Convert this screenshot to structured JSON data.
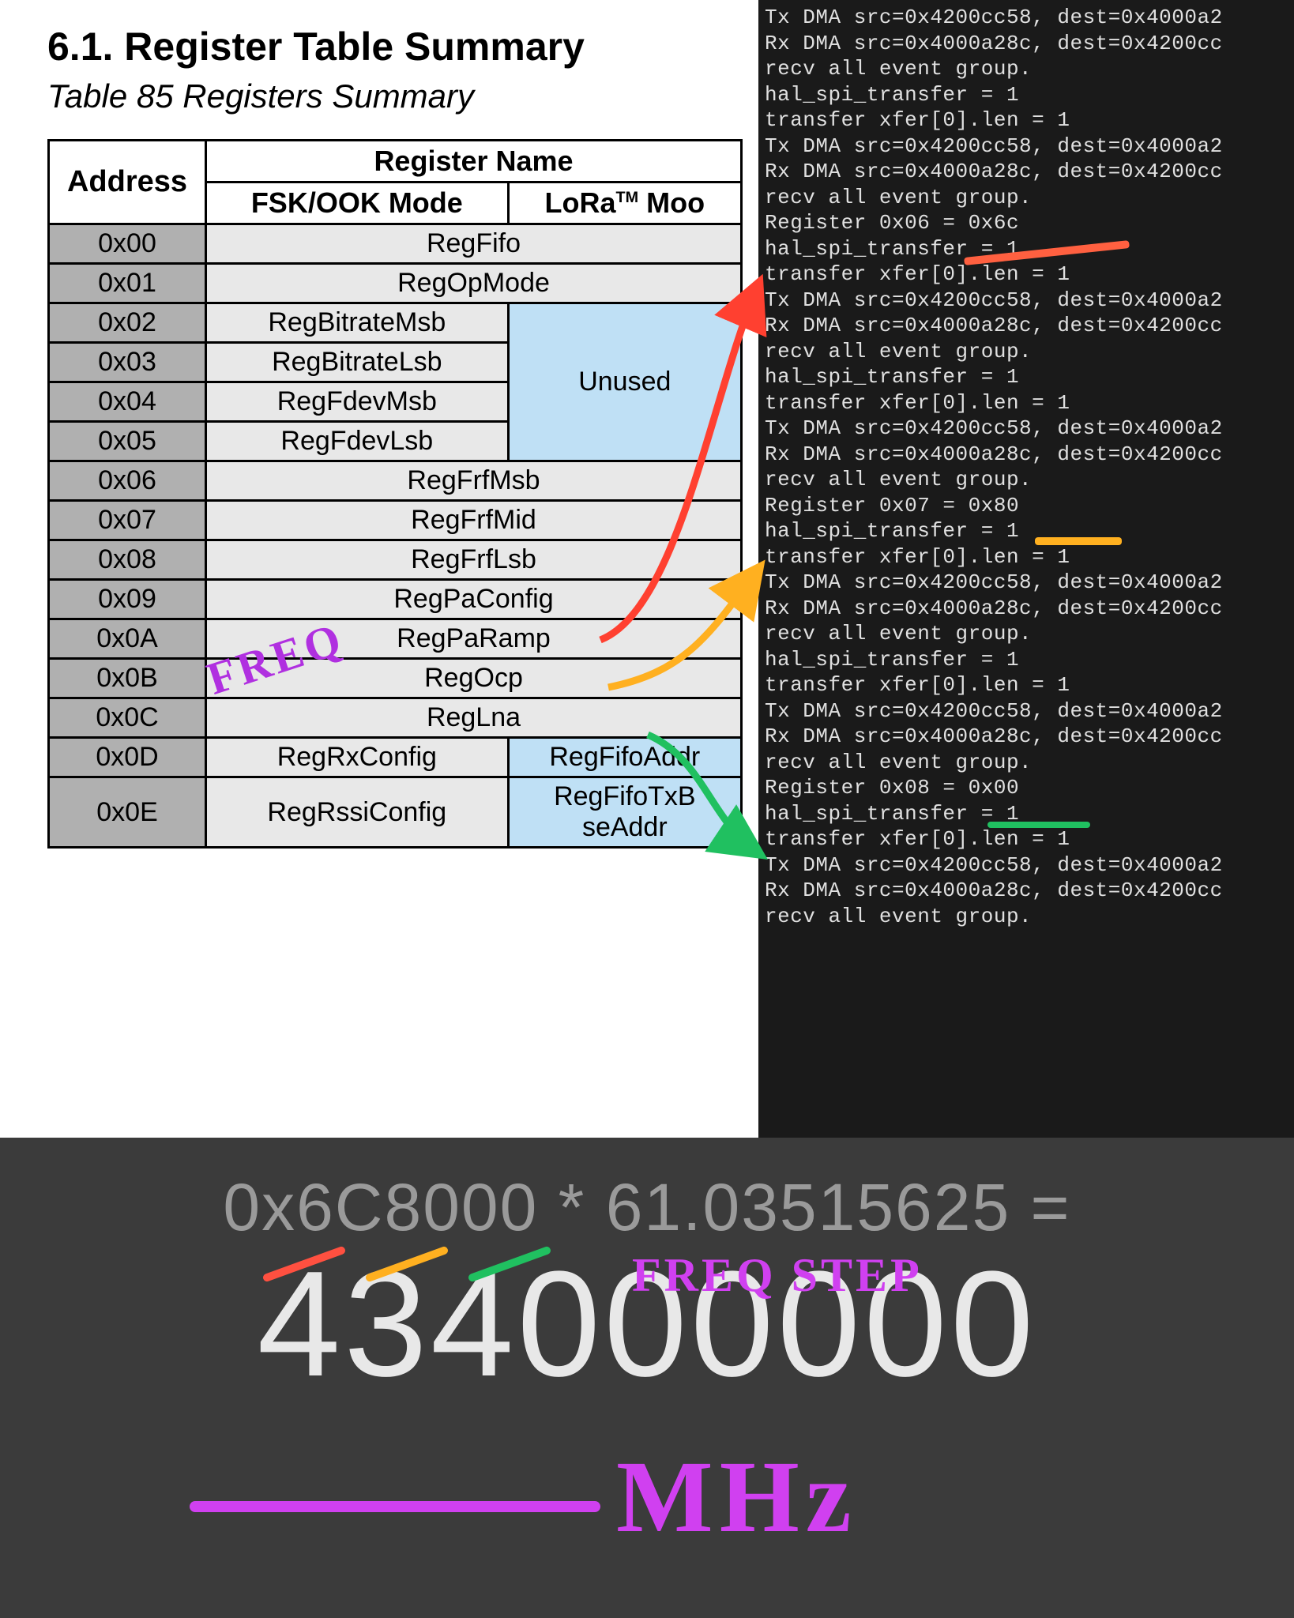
{
  "doc": {
    "heading": "6.1.  Register Table Summary",
    "subhead": "Table 85  Registers Summary",
    "hdr_address": "Address",
    "hdr_regname": "Register Name",
    "hdr_fsk": "FSK/OOK Mode",
    "hdr_lora_pre": "LoRa",
    "hdr_lora_tm": "TM",
    "hdr_lora_post": " Moo",
    "rows": {
      "r00": "0x00",
      "v00": "RegFifo",
      "r01": "0x01",
      "v01": "RegOpMode",
      "r02": "0x02",
      "v02": "RegBitrateMsb",
      "r03": "0x03",
      "v03": "RegBitrateLsb",
      "r04": "0x04",
      "v04": "RegFdevMsb",
      "r05": "0x05",
      "v05": "RegFdevLsb",
      "unused": "Unused",
      "r06": "0x06",
      "v06": "RegFrfMsb",
      "r07": "0x07",
      "v07": "RegFrfMid",
      "r08": "0x08",
      "v08": "RegFrfLsb",
      "r09": "0x09",
      "v09": "RegPaConfig",
      "r0A": "0x0A",
      "v0A": "RegPaRamp",
      "r0B": "0x0B",
      "v0B": "RegOcp",
      "r0C": "0x0C",
      "v0C": "RegLna",
      "r0D": "0x0D",
      "v0Df": "RegRxConfig",
      "v0Dl": "RegFifoAddr",
      "r0E": "0x0E",
      "v0Ef": "RegRssiConfig",
      "v0El": "RegFifoTxB\nseAddr"
    }
  },
  "terminal_lines": [
    "Tx DMA src=0x4200cc58, dest=0x4000a2",
    "Rx DMA src=0x4000a28c, dest=0x4200cc",
    "recv all event group.",
    "hal_spi_transfer = 1",
    "transfer xfer[0].len = 1",
    "Tx DMA src=0x4200cc58, dest=0x4000a2",
    "Rx DMA src=0x4000a28c, dest=0x4200cc",
    "recv all event group.",
    "Register 0x06 = 0x6c",
    "hal_spi_transfer = 1",
    "transfer xfer[0].len = 1",
    "Tx DMA src=0x4200cc58, dest=0x4000a2",
    "Rx DMA src=0x4000a28c, dest=0x4200cc",
    "recv all event group.",
    "hal_spi_transfer = 1",
    "transfer xfer[0].len = 1",
    "Tx DMA src=0x4200cc58, dest=0x4000a2",
    "Rx DMA src=0x4000a28c, dest=0x4200cc",
    "recv all event group.",
    "Register 0x07 = 0x80",
    "hal_spi_transfer = 1",
    "transfer xfer[0].len = 1",
    "Tx DMA src=0x4200cc58, dest=0x4000a2",
    "Rx DMA src=0x4000a28c, dest=0x4200cc",
    "recv all event group.",
    "hal_spi_transfer = 1",
    "transfer xfer[0].len = 1",
    "Tx DMA src=0x4200cc58, dest=0x4000a2",
    "Rx DMA src=0x4000a28c, dest=0x4200cc",
    "recv all event group.",
    "Register 0x08 = 0x00",
    "hal_spi_transfer = 1",
    "transfer xfer[0].len = 1",
    "Tx DMA src=0x4200cc58, dest=0x4000a2",
    "Rx DMA src=0x4000a28c, dest=0x4200cc",
    "recv all event group."
  ],
  "calc": {
    "expr": "0x6C8000 * 61.03515625 =",
    "result": "434000000"
  },
  "ann": {
    "freq": "FREQ",
    "freq_step": "FREQ STEP",
    "mhz": "MHz"
  },
  "colors": {
    "red": "#ff5040",
    "yellow": "#ffb020",
    "green": "#20c060",
    "purple": "#d040f0"
  }
}
